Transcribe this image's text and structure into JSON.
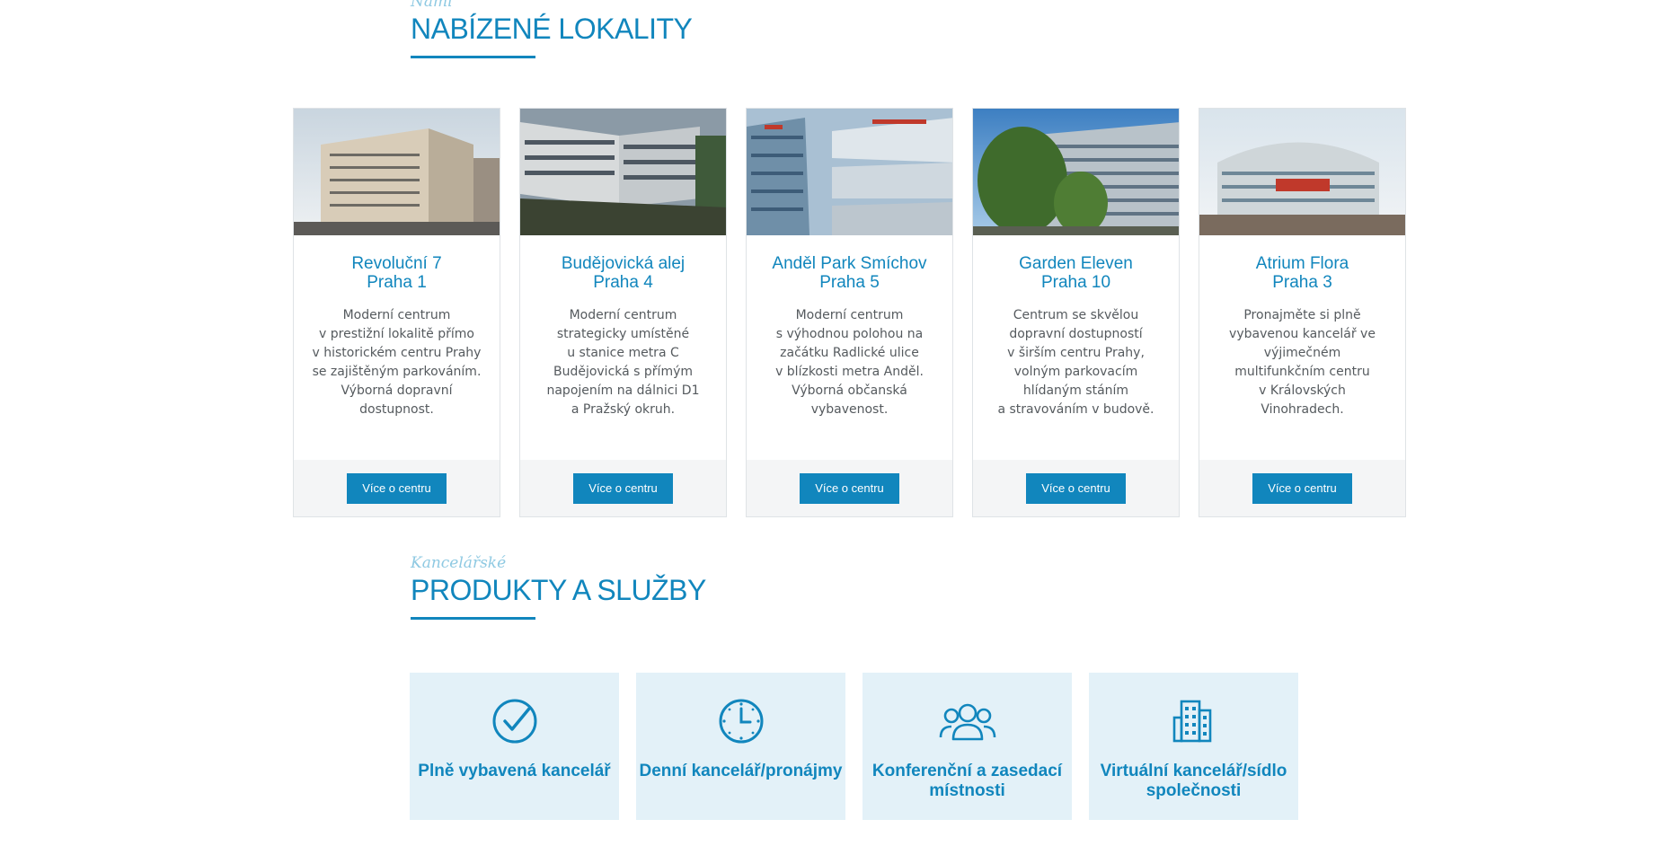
{
  "locations": {
    "kicker": "Námi",
    "title": "NABÍZENÉ LOKALITY",
    "cards": [
      {
        "name": "Revoluční 7\nPraha 1",
        "description": "Moderní centrum\nv prestižní lokalitě přímo\nv historickém centru Prahy\nse zajištěným parkováním.\nVýborná dopravní\ndostupnost.",
        "button": "Více o centru"
      },
      {
        "name": "Budějovická alej\nPraha 4",
        "description": "Moderní centrum\nstrategicky umístěné\nu stanice metra C\nBudějovická s přímým\nnapojením na dálnici D1\na Pražský okruh.",
        "button": "Více o centru"
      },
      {
        "name": "Anděl Park Smíchov\nPraha 5",
        "description": "Moderní centrum\ns výhodnou polohou na\nzačátku Radlické ulice\nv blízkosti metra Anděl.\nVýborná občanská\nvybavenost.",
        "button": "Více o centru"
      },
      {
        "name": "Garden Eleven\nPraha 10",
        "description": "Centrum se skvělou\ndopravní dostupností\nv širším centru Prahy,\nvolným parkovacím\nhlídaným stáním\na stravováním v budově.",
        "button": "Více o centru"
      },
      {
        "name": "Atrium Flora\nPraha 3",
        "description": "Pronajměte si plně\nvybavenou kancelář ve\nvýjimečném\nmultifunkčním centru\nv Královských\nVinohradech.",
        "button": "Více o centru"
      }
    ]
  },
  "services": {
    "kicker": "Kancelářské",
    "title": "PRODUKTY A SLUŽBY",
    "items": [
      {
        "icon": "check-circle-icon",
        "label": "Plně vybavená kancelář"
      },
      {
        "icon": "clock-icon",
        "label": "Denní kancelář/pronájmy"
      },
      {
        "icon": "people-icon",
        "label": "Konferenční a zasedací\nmístnosti"
      },
      {
        "icon": "building-icon",
        "label": "Virtuální kancelář/sídlo\nspolečnosti"
      }
    ]
  },
  "colors": {
    "brand_blue": "#1186bd",
    "kicker_blue": "#8ec9e2",
    "service_bg": "#e3f1f8",
    "card_footer": "#f4f5f6"
  }
}
